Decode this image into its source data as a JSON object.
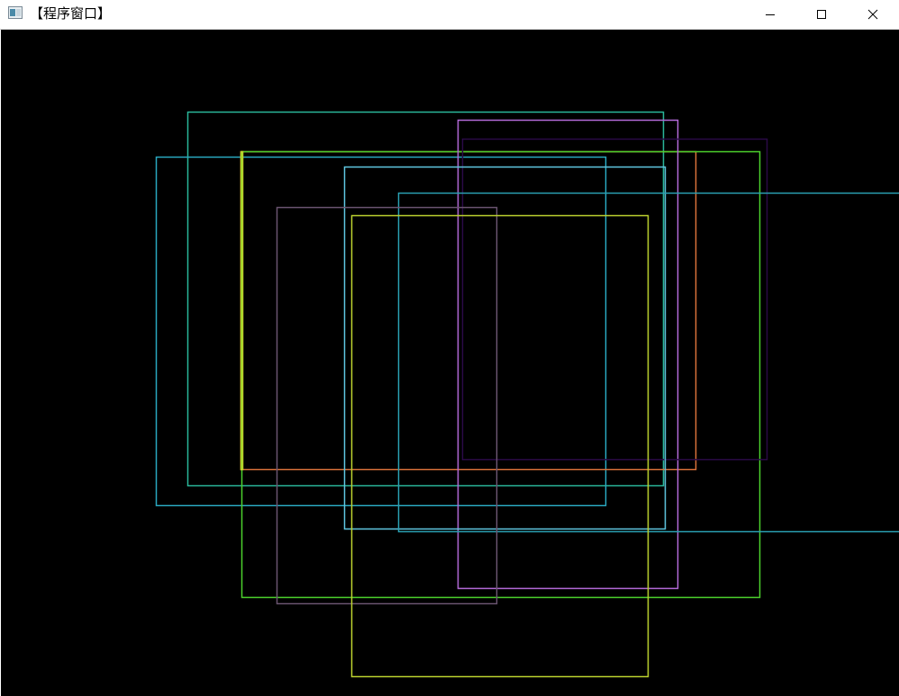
{
  "window": {
    "title": "【程序窗口】",
    "controls": {
      "minimize": "minimize",
      "maximize": "maximize",
      "close": "close"
    }
  },
  "canvas": {
    "background": "#000000",
    "rectangles": [
      {
        "color": "#2ab69a",
        "name": "teal-rect"
      },
      {
        "color": "#2aa8c0",
        "name": "cyan-rect-left"
      },
      {
        "color": "#d9713a",
        "name": "orange-rect"
      },
      {
        "color": "#4cd12c",
        "name": "green-rect"
      },
      {
        "color": "#c8d62a",
        "name": "yellow-rect"
      },
      {
        "color": "#b36ad8",
        "name": "purple-rect"
      },
      {
        "color": "#2a0a46",
        "name": "dark-violet-rect"
      },
      {
        "color": "#5fc6e0",
        "name": "light-cyan-rect"
      },
      {
        "color": "#2a9fb2",
        "name": "teal-rect-right"
      },
      {
        "color": "#6a5470",
        "name": "mauve-rect"
      },
      {
        "color": "#bcd22e",
        "name": "lime-rect"
      }
    ]
  }
}
